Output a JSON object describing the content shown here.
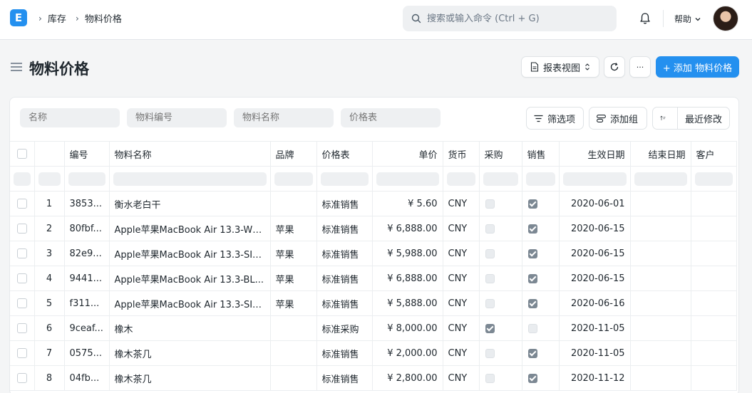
{
  "navbar": {
    "logo": "E",
    "breadcrumbs": [
      "库存",
      "物料价格"
    ],
    "search_placeholder": "搜索或输入命令 (Ctrl + G)",
    "help_label": "帮助"
  },
  "page": {
    "title": "物料价格",
    "report_view_label": "报表视图",
    "more_label": "···",
    "add_label": "+ 添加 物料价格"
  },
  "filters": {
    "placeholders": [
      "名称",
      "物料编号",
      "物料名称",
      "价格表"
    ],
    "filter_btn": "筛选项",
    "group_btn": "添加组",
    "sort_btn": "最近修改"
  },
  "table": {
    "columns": [
      "编号",
      "物料名称",
      "品牌",
      "价格表",
      "单价",
      "货币",
      "采购",
      "销售",
      "生效日期",
      "结束日期",
      "客户"
    ],
    "rows": [
      {
        "idx": "1",
        "id": "3853...",
        "name": "衡水老白干",
        "brand": "",
        "price_list": "标准销售",
        "rate": "¥ 5.60",
        "currency": "CNY",
        "buying": false,
        "selling": true,
        "valid_from": "2020-06-01",
        "valid_upto": "",
        "customer": ""
      },
      {
        "idx": "2",
        "id": "80fbf...",
        "name": "Apple苹果MacBook Air 13.3-WH...",
        "brand": "苹果",
        "price_list": "标准销售",
        "rate": "¥ 6,888.00",
        "currency": "CNY",
        "buying": false,
        "selling": true,
        "valid_from": "2020-06-15",
        "valid_upto": "",
        "customer": ""
      },
      {
        "idx": "3",
        "id": "82e9...",
        "name": "Apple苹果MacBook Air 13.3-SIL...",
        "brand": "苹果",
        "price_list": "标准销售",
        "rate": "¥ 5,988.00",
        "currency": "CNY",
        "buying": false,
        "selling": true,
        "valid_from": "2020-06-15",
        "valid_upto": "",
        "customer": ""
      },
      {
        "idx": "4",
        "id": "9441...",
        "name": "Apple苹果MacBook Air 13.3-BL...",
        "brand": "苹果",
        "price_list": "标准销售",
        "rate": "¥ 6,888.00",
        "currency": "CNY",
        "buying": false,
        "selling": true,
        "valid_from": "2020-06-15",
        "valid_upto": "",
        "customer": ""
      },
      {
        "idx": "5",
        "id": "f311...",
        "name": "Apple苹果MacBook Air 13.3-SIL...",
        "brand": "苹果",
        "price_list": "标准销售",
        "rate": "¥ 5,888.00",
        "currency": "CNY",
        "buying": false,
        "selling": true,
        "valid_from": "2020-06-16",
        "valid_upto": "",
        "customer": ""
      },
      {
        "idx": "6",
        "id": "9ceaf...",
        "name": "橡木",
        "brand": "",
        "price_list": "标准采购",
        "rate": "¥ 8,000.00",
        "currency": "CNY",
        "buying": true,
        "selling": false,
        "valid_from": "2020-11-05",
        "valid_upto": "",
        "customer": ""
      },
      {
        "idx": "7",
        "id": "0575...",
        "name": "橡木茶几",
        "brand": "",
        "price_list": "标准销售",
        "rate": "¥ 2,000.00",
        "currency": "CNY",
        "buying": false,
        "selling": true,
        "valid_from": "2020-11-05",
        "valid_upto": "",
        "customer": ""
      },
      {
        "idx": "8",
        "id": "04fb...",
        "name": "橡木茶几",
        "brand": "",
        "price_list": "标准销售",
        "rate": "¥ 2,800.00",
        "currency": "CNY",
        "buying": false,
        "selling": true,
        "valid_from": "2020-11-12",
        "valid_upto": "",
        "customer": ""
      }
    ]
  },
  "colors": {
    "primary": "#2490ef",
    "checked": "#7c8893"
  }
}
